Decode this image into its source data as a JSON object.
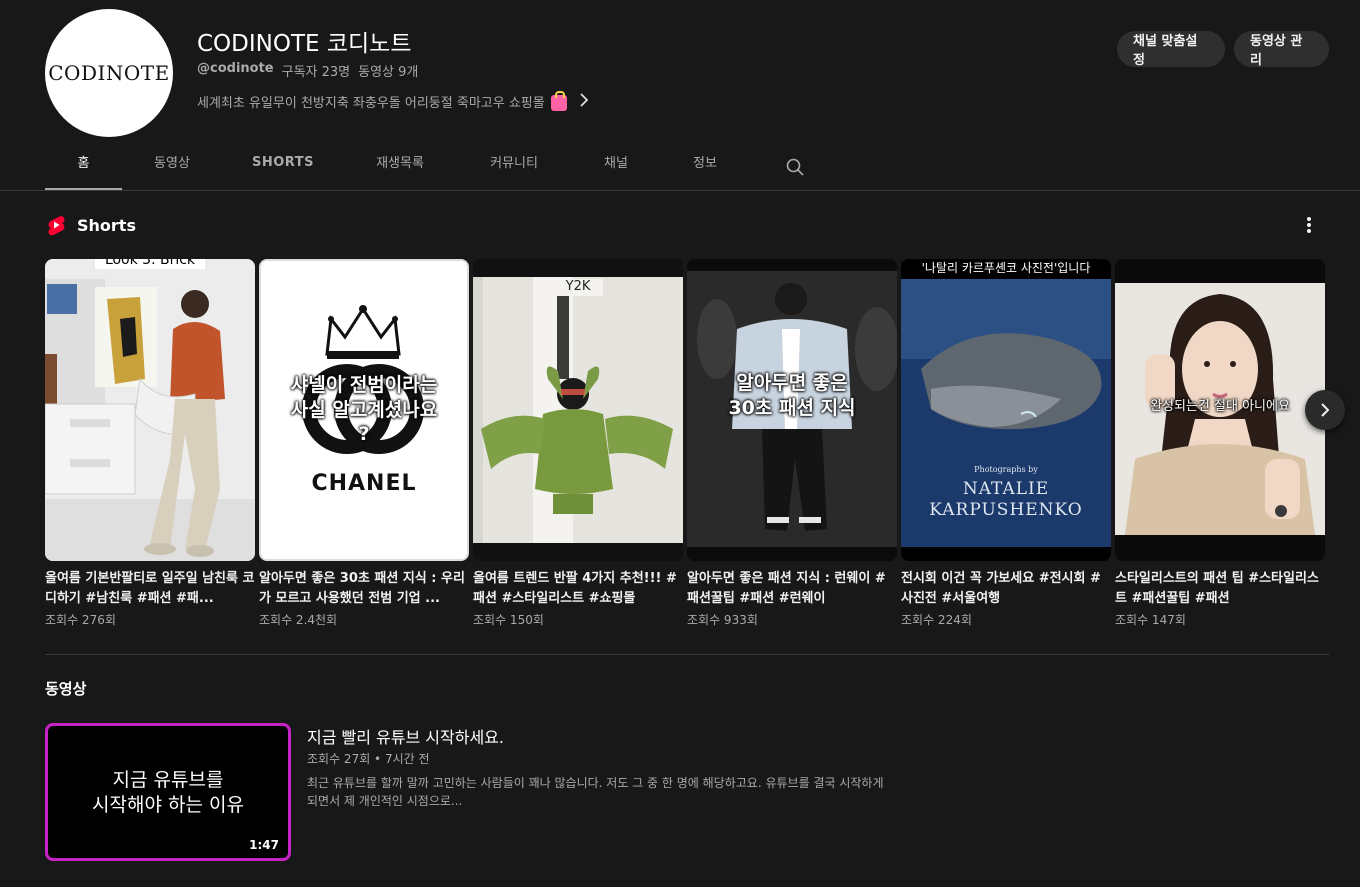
{
  "channel": {
    "avatar_text": "CODINOTE",
    "title": "CODINOTE 코디노트",
    "handle": "@codinote",
    "subscribers": "구독자 23명",
    "video_count": "동영상 9개",
    "description": "세계최초 유일무이 천방지축 좌충우돌 어리둥절 죽마고우 쇼핑몰",
    "customize_label": "채널 맞춤설정",
    "manage_label": "동영상 관리"
  },
  "tabs": [
    {
      "label": "홈",
      "active": true
    },
    {
      "label": "동영상"
    },
    {
      "label": "SHORTS"
    },
    {
      "label": "재생목록"
    },
    {
      "label": "커뮤니티"
    },
    {
      "label": "채널"
    },
    {
      "label": "정보"
    }
  ],
  "shorts": {
    "section_title": "Shorts",
    "items": [
      {
        "title": "올여름 기본반팔티로 일주일 남친룩 코디하기 #남친룩 #패션 #패...",
        "views": "조회수 276회",
        "overlay": "Look 3. Brick"
      },
      {
        "title": "알아두면 좋은 30초 패션 지식 : 우리가 모르고 사용했던 전범 기업 ...",
        "views": "조회수 2.4천회",
        "overlay": "샤넬이 전범이라는 사실 알고계셨나요 ?",
        "brand": "CHANEL"
      },
      {
        "title": "올여름 트렌드 반팔 4가지 추천!!! #패션 #스타일리스트 #쇼핑몰",
        "views": "조회수 150회",
        "overlay": "Y2K"
      },
      {
        "title": "알아두면 좋은 패션 지식 : 런웨이 #패션꿀팁 #패션 #런웨이",
        "views": "조회수 933회",
        "overlay": "알아두면 좋은 30초 패션 지식"
      },
      {
        "title": "전시회 이건 꼭 가보세요 #전시회 #사진전 #서울여행",
        "views": "조회수 224회",
        "overlay": "'나탈리 카르푸셴코 사진전'입니다",
        "caption_small": "Photographs by",
        "caption_name": "NATALIE KARPUSHENKO"
      },
      {
        "title": "스타일리스트의 패션 팁 #스타일리스트 #패션꿀팁 #패션",
        "views": "조회수 147회",
        "overlay": "완성되는건 절대 아니에요"
      }
    ]
  },
  "videos": {
    "section_title": "동영상",
    "item": {
      "thumb_text": "지금 유튜브를 시작해야 하는 이유",
      "thumb_line1": "지금 유튜브를",
      "thumb_line2": "시작해야 하는 이유",
      "duration": "1:47",
      "title": "지금 빨리 유튜브 시작하세요.",
      "meta": "조회수 27회 • 7시간 전",
      "description": "최근 유튜브를 할까 말까 고민하는 사람들이 꽤나 많습니다. 저도 그 중 한 명에 해당하고요. 유튜브를 결국 시작하게 되면서 제 개인적인 시점으로..."
    }
  },
  "colors": {
    "background": "#181818",
    "accent_border": "#c623c6",
    "shorts_red": "#ff0033"
  }
}
